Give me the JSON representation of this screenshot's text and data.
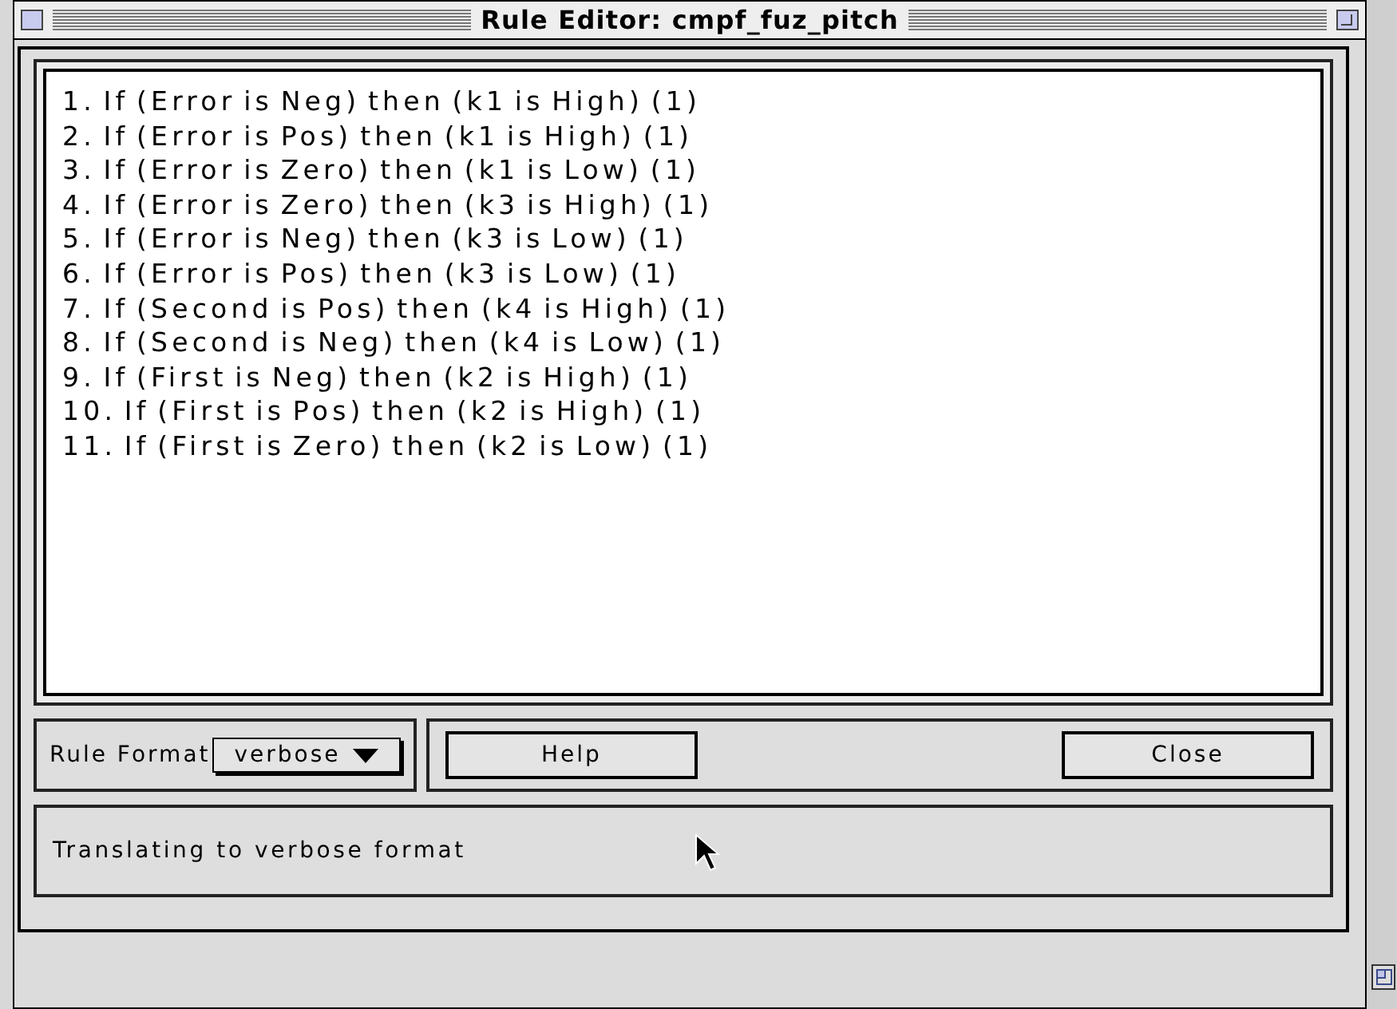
{
  "window": {
    "title": "Rule Editor: cmpf_fuz_pitch"
  },
  "rules": [
    "1. If (Error is Neg) then (k1 is High) (1)",
    "2. If (Error is Pos) then (k1 is High) (1)",
    "3. If (Error is Zero) then (k1 is Low) (1)",
    "4. If (Error is Zero) then (k3 is High) (1)",
    "5. If (Error is Neg) then (k3 is Low) (1)",
    "6. If (Error is Pos) then (k3 is Low) (1)",
    "7. If (Second is Pos) then (k4 is High) (1)",
    "8. If (Second is Neg) then (k4 is Low) (1)",
    "9. If (First is Neg) then (k2 is High) (1)",
    "10. If (First is Pos) then (k2 is High) (1)",
    "11. If (First is Zero) then (k2 is Low) (1)"
  ],
  "rule_format": {
    "label": "Rule Format",
    "value": "verbose"
  },
  "buttons": [
    "Help",
    "Close"
  ],
  "status": "Translating to verbose format"
}
